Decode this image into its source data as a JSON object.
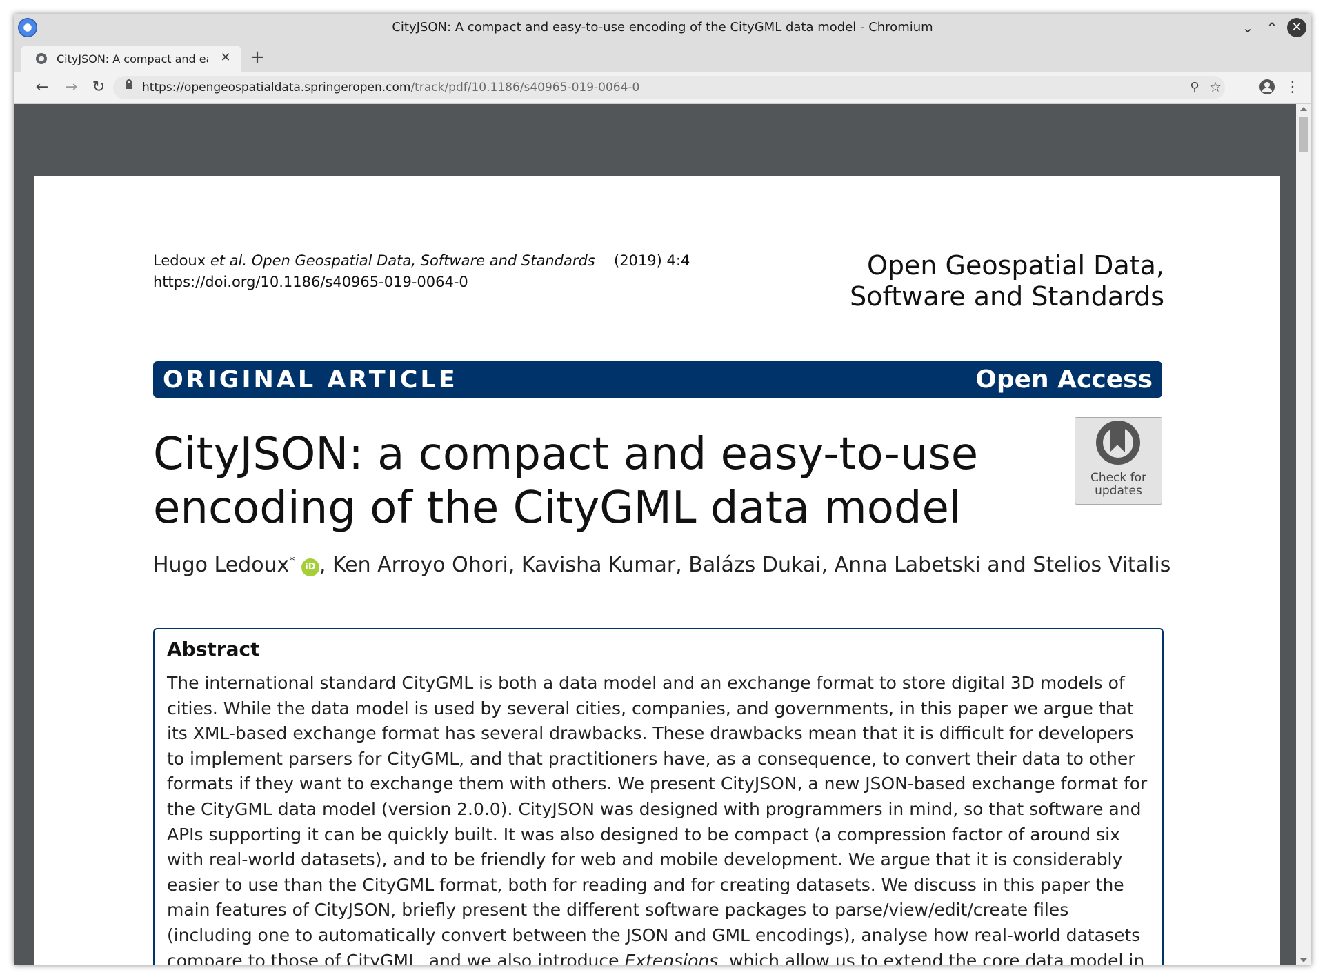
{
  "window": {
    "title": "CityJSON: A compact and easy-to-use encoding of the CityGML data model - Chromium"
  },
  "tabs": [
    {
      "title": "CityJSON: A compact and eas",
      "active": true
    }
  ],
  "toolbar": {
    "url_host": "https://opengeospatialdata.springeropen.com",
    "url_path": "/track/pdf/10.1186/s40965-019-0064-0"
  },
  "document": {
    "citation_prefix": "Ledoux ",
    "citation_etal": "et al.",
    "citation_journal": " Open Geospatial Data, Software and Standards",
    "citation_year": "(2019) 4:4",
    "doi": "https://doi.org/10.1186/s40965-019-0064-0",
    "journal_line1": "Open Geospatial Data,",
    "journal_line2": "Software and Standards",
    "banner_left": "ORIGINAL ARTICLE",
    "banner_right": "Open Access",
    "title_line1": "CityJSON: a compact and easy-to-use",
    "title_line2": "encoding of the CityGML data model",
    "check_updates_line1": "Check for",
    "check_updates_line2": "updates",
    "first_author": "Hugo Ledoux",
    "first_author_mark": "*",
    "orcid_label": "iD",
    "other_authors": ", Ken Arroyo Ohori, Kavisha Kumar, Balázs Dukai, Anna Labetski and Stelios Vitalis",
    "abstract_heading": "Abstract",
    "abstract_text_main": "The  international  standard CityGML is both a data model and an exchange format to store digital 3D models of cities. While the data model is used by several cities, companies, and governments, in this paper we argue that its XML-based exchange format has several drawbacks. These drawbacks mean that it is difficult for developers to implement parsers for CityGML, and that practitioners have, as a consequence, to convert their data to other formats if they want to exchange them with others. We present CityJSON, a new JSON-based exchange format for the CityGML data model (version 2.0.0). CityJSON was designed with programmers in mind, so that software and APIs supporting it can be quickly built. It was also designed to be compact (a compression factor of around six with real-world datasets), and to be friendly for web and mobile development. We argue that it is considerably easier to use than the CityGML format, both for reading and for creating datasets. We discuss in this paper the main features of CityJSON, briefly present the different software packages to parse/view/edit/create files (including one to automatically convert between the JSON and GML encodings), analyse how real-world datasets compare to those of CityGML, and we also introduce ",
    "abstract_text_italic": "Extensions",
    "abstract_text_end": ", which allow us to extend the core data model in a documented manner."
  },
  "colors": {
    "banner": "#00336a",
    "viewer_background": "#525659",
    "orcid": "#a6ce39"
  },
  "icons": {
    "back": "arrow-left-icon",
    "forward": "arrow-right-icon",
    "reload": "reload-icon",
    "lock": "lock-icon",
    "zoom": "zoom-in-icon",
    "bookmark": "star-icon",
    "profile": "account-icon",
    "menu": "kebab-menu-icon"
  }
}
